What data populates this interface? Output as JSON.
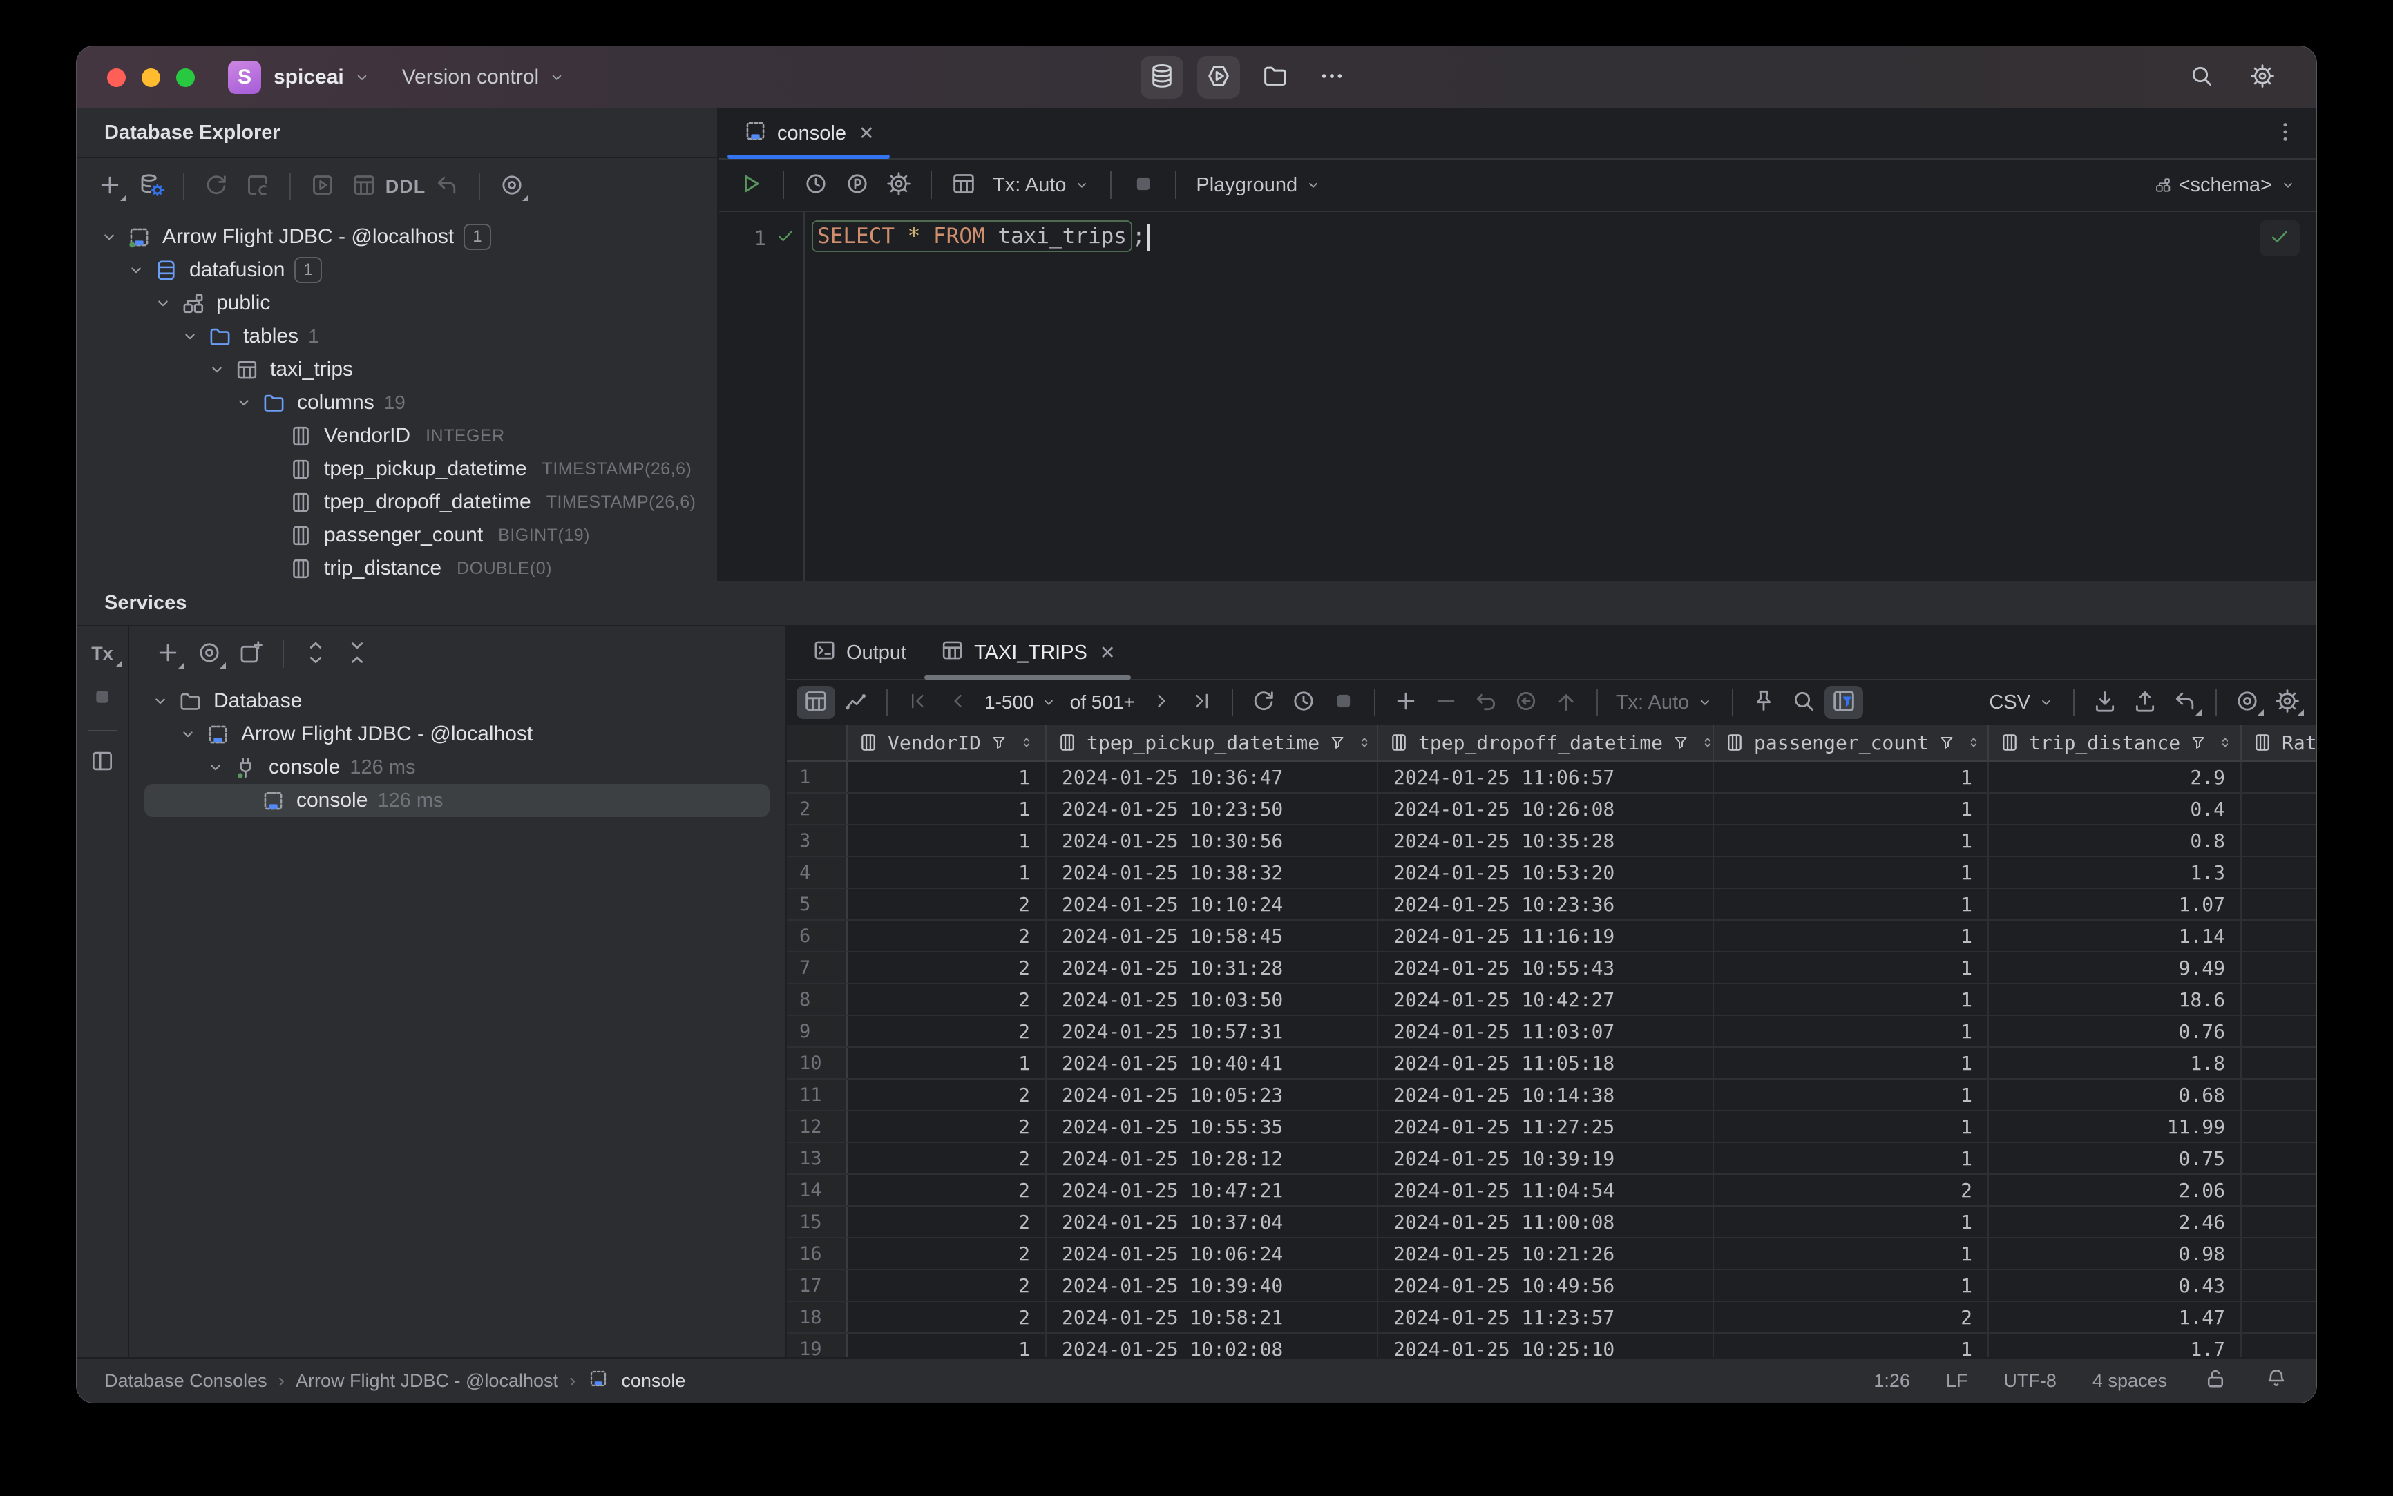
{
  "titlebar": {
    "logo_letter": "S",
    "project": "spiceai",
    "menu_version_control": "Version control"
  },
  "database_explorer": {
    "title": "Database Explorer",
    "toolbar": {
      "ddl_label": "DDL"
    },
    "tree": [
      {
        "icon": "jdbc-connected",
        "label": "Arrow Flight JDBC - @localhost",
        "badge": "1",
        "level": 0,
        "chevron": true
      },
      {
        "icon": "database",
        "label": "datafusion",
        "badge": "1",
        "level": 1,
        "chevron": true
      },
      {
        "icon": "schema",
        "label": "public",
        "level": 2,
        "chevron": true
      },
      {
        "icon": "folder",
        "label": "tables",
        "count": "1",
        "level": 3,
        "chevron": true
      },
      {
        "icon": "table",
        "label": "taxi_trips",
        "level": 4,
        "chevron": true
      },
      {
        "icon": "folder",
        "label": "columns",
        "count": "19",
        "level": 5,
        "chevron": true
      },
      {
        "icon": "column",
        "label": "VendorID",
        "type": "INTEGER",
        "level": 6
      },
      {
        "icon": "column",
        "label": "tpep_pickup_datetime",
        "type": "TIMESTAMP(26,6)",
        "level": 6
      },
      {
        "icon": "column",
        "label": "tpep_dropoff_datetime",
        "type": "TIMESTAMP(26,6)",
        "level": 6
      },
      {
        "icon": "column",
        "label": "passenger_count",
        "type": "BIGINT(19)",
        "level": 6
      },
      {
        "icon": "column",
        "label": "trip_distance",
        "type": "DOUBLE(0)",
        "level": 6
      }
    ]
  },
  "editor": {
    "tab_label": "console",
    "toolbar": {
      "tx_label": "Tx: Auto",
      "playground_label": "Playground",
      "schema_label": "<schema>"
    },
    "line_number": "1",
    "sql_tokens": [
      {
        "text": "SELECT",
        "style": "keyword"
      },
      {
        "text": " ",
        "style": "plain"
      },
      {
        "text": "*",
        "style": "star"
      },
      {
        "text": " ",
        "style": "plain"
      },
      {
        "text": "FROM",
        "style": "keyword"
      },
      {
        "text": " taxi_trips",
        "style": "ident"
      },
      {
        "text": ";",
        "style": "plain"
      }
    ]
  },
  "services": {
    "title": "Services",
    "tx_label": "Tx",
    "tree": [
      {
        "icon": "folder-plain",
        "label": "Database",
        "level": 0,
        "chevron": true
      },
      {
        "icon": "jdbc",
        "label": "Arrow Flight JDBC - @localhost",
        "level": 1,
        "chevron": true
      },
      {
        "icon": "plug",
        "label": "console",
        "suffix": "126 ms",
        "level": 2,
        "chevron": true
      },
      {
        "icon": "jdbc",
        "label": "console",
        "suffix": "126 ms",
        "level": 3,
        "selected": true
      }
    ]
  },
  "results": {
    "output_tab": "Output",
    "result_tab": "TAXI_TRIPS",
    "pager_range": "1-500",
    "pager_total": "of 501+",
    "tx_label": "Tx: Auto",
    "format_label": "CSV",
    "columns": [
      "VendorID",
      "tpep_pickup_datetime",
      "tpep_dropoff_datetime",
      "passenger_count",
      "trip_distance",
      "Rate"
    ],
    "rows": [
      [
        "1",
        "2024-01-25 10:36:47",
        "2024-01-25 11:06:57",
        "1",
        "2.9",
        ""
      ],
      [
        "1",
        "2024-01-25 10:23:50",
        "2024-01-25 10:26:08",
        "1",
        "0.4",
        ""
      ],
      [
        "1",
        "2024-01-25 10:30:56",
        "2024-01-25 10:35:28",
        "1",
        "0.8",
        ""
      ],
      [
        "1",
        "2024-01-25 10:38:32",
        "2024-01-25 10:53:20",
        "1",
        "1.3",
        ""
      ],
      [
        "2",
        "2024-01-25 10:10:24",
        "2024-01-25 10:23:36",
        "1",
        "1.07",
        ""
      ],
      [
        "2",
        "2024-01-25 10:58:45",
        "2024-01-25 11:16:19",
        "1",
        "1.14",
        ""
      ],
      [
        "2",
        "2024-01-25 10:31:28",
        "2024-01-25 10:55:43",
        "1",
        "9.49",
        ""
      ],
      [
        "2",
        "2024-01-25 10:03:50",
        "2024-01-25 10:42:27",
        "1",
        "18.6",
        ""
      ],
      [
        "2",
        "2024-01-25 10:57:31",
        "2024-01-25 11:03:07",
        "1",
        "0.76",
        ""
      ],
      [
        "1",
        "2024-01-25 10:40:41",
        "2024-01-25 11:05:18",
        "1",
        "1.8",
        ""
      ],
      [
        "2",
        "2024-01-25 10:05:23",
        "2024-01-25 10:14:38",
        "1",
        "0.68",
        ""
      ],
      [
        "2",
        "2024-01-25 10:55:35",
        "2024-01-25 11:27:25",
        "1",
        "11.99",
        ""
      ],
      [
        "2",
        "2024-01-25 10:28:12",
        "2024-01-25 10:39:19",
        "1",
        "0.75",
        ""
      ],
      [
        "2",
        "2024-01-25 10:47:21",
        "2024-01-25 11:04:54",
        "2",
        "2.06",
        ""
      ],
      [
        "2",
        "2024-01-25 10:37:04",
        "2024-01-25 11:00:08",
        "1",
        "2.46",
        ""
      ],
      [
        "2",
        "2024-01-25 10:06:24",
        "2024-01-25 10:21:26",
        "1",
        "0.98",
        ""
      ],
      [
        "2",
        "2024-01-25 10:39:40",
        "2024-01-25 10:49:56",
        "1",
        "0.43",
        ""
      ],
      [
        "2",
        "2024-01-25 10:58:21",
        "2024-01-25 11:23:57",
        "2",
        "1.47",
        ""
      ],
      [
        "1",
        "2024-01-25 10:02:08",
        "2024-01-25 10:25:10",
        "1",
        "1.7",
        ""
      ]
    ]
  },
  "status_bar": {
    "breadcrumbs": [
      "Database Consoles",
      "Arrow Flight JDBC - @localhost",
      "console"
    ],
    "caret": "1:26",
    "line_separator": "LF",
    "encoding": "UTF-8",
    "indent": "4 spaces"
  }
}
